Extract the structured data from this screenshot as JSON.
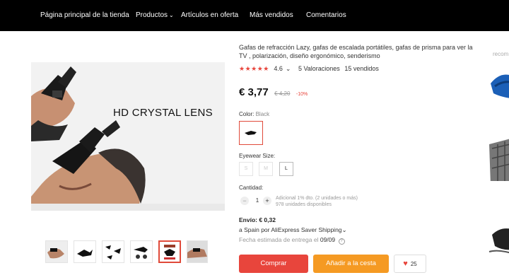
{
  "nav": {
    "items": [
      {
        "label": "Página principal de la tienda"
      },
      {
        "label": "Productos",
        "chevron": "⌄"
      },
      {
        "label": "Artículos en oferta"
      },
      {
        "label": "Más vendidos"
      },
      {
        "label": "Comentarios"
      }
    ]
  },
  "gallery": {
    "main_image_text": "HD CRYSTAL LENS",
    "thumbnail_count": 6,
    "active_thumbnail": 5
  },
  "product": {
    "title": "Gafas de refracción Lazy, gafas de escalada portátiles, gafas de prisma para ver la TV , polarización, diseño ergonómico, senderismo",
    "stars": "★★★★★",
    "rating": "4.6",
    "rating_chevron": "⌄",
    "reviews": "5 Valoraciones",
    "sold": "15 vendidos",
    "price": "€ 3,77",
    "old_price": "€ 4,20",
    "discount": "-10%"
  },
  "color": {
    "label": "Color:",
    "value": "Black"
  },
  "size": {
    "label": "Eyewear Size:",
    "options": [
      {
        "label": "S",
        "enabled": false
      },
      {
        "label": "M",
        "enabled": false
      },
      {
        "label": "L",
        "enabled": true
      }
    ]
  },
  "quantity": {
    "label": "Cantidad:",
    "minus": "−",
    "value": "1",
    "plus": "+",
    "note_1": "Adicional 1% dto. (2 unidades o más)",
    "note_2": "978 unidades disponibles"
  },
  "shipping": {
    "cost": "Envío: € 0,32",
    "method": "a Spain por AliExpress Saver Shipping",
    "method_chevron": "⌄",
    "eta_label": "Fecha estimada de entrega el",
    "eta_date": "09/09",
    "help": "?"
  },
  "actions": {
    "buy": "Comprar",
    "add_to_cart": "Añadir a la cesta",
    "wishlist_count": "25"
  },
  "recommended": {
    "title": "recom"
  },
  "colors": {
    "accent": "#e8453c",
    "cart": "#f59a23",
    "nav_bg": "#000000"
  }
}
